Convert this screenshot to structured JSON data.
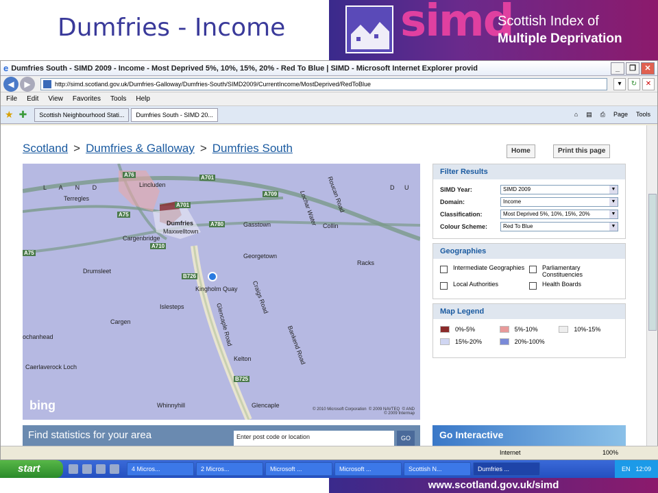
{
  "slide": {
    "title": "Dumfries - Income"
  },
  "banner": {
    "brand": "simd",
    "line1": "Scottish Index of",
    "line2": "Multiple Deprivation"
  },
  "browser": {
    "title": "Dumfries South - SIMD 2009 - Income - Most Deprived 5%, 10%, 15%, 20% - Red To Blue | SIMD - Microsoft Internet Explorer provid",
    "url": "http://simd.scotland.gov.uk/Dumfries-Galloway/Dumfries-South/SIMD2009/CurrentIncome/MostDeprived/RedToBlue",
    "menu": [
      "File",
      "Edit",
      "View",
      "Favorites",
      "Tools",
      "Help"
    ],
    "tabs": [
      "Scottish Neighbourhood Stati...",
      "Dumfries South - SIMD 20..."
    ],
    "tools": [
      "Page",
      "Tools"
    ],
    "status": {
      "zone": "Internet",
      "zoom": "100%"
    }
  },
  "breadcrumb": [
    "Scotland",
    "Dumfries & Galloway",
    "Dumfries South"
  ],
  "buttons": {
    "home": "Home",
    "print": "Print this page"
  },
  "filter": {
    "header": "Filter Results",
    "rows": [
      {
        "label": "SIMD Year:",
        "value": "SIMD 2009"
      },
      {
        "label": "Domain:",
        "value": "Income"
      },
      {
        "label": "Classification:",
        "value": "Most Deprived 5%, 10%, 15%, 20%"
      },
      {
        "label": "Colour Scheme:",
        "value": "Red To Blue"
      }
    ]
  },
  "geographies": {
    "header": "Geographies",
    "items": [
      "Intermediate Geographies",
      "Parliamentary Constituencies",
      "Local Authorities",
      "Health Boards"
    ]
  },
  "legend": {
    "header": "Map Legend",
    "items": [
      {
        "label": "0%-5%",
        "color": "#8a2a2a"
      },
      {
        "label": "5%-10%",
        "color": "#e89a9a"
      },
      {
        "label": "10%-15%",
        "color": "#eeeeee"
      },
      {
        "label": "15%-20%",
        "color": "#d0d6f2"
      },
      {
        "label": "20%-100%",
        "color": "#7a8ad8"
      }
    ]
  },
  "map": {
    "places": [
      "Lincluden",
      "Terregles",
      "Dumfries",
      "Maxwelltown",
      "Gasstown",
      "Collin",
      "Cargenbridge",
      "Georgetown",
      "Racks",
      "Drumsleet",
      "Kingholm Quay",
      "Islesteps",
      "Cargen",
      "Kelton",
      "ochanhead",
      "Caerlaverock Loch",
      "Whinnyhill",
      "Glencaple",
      "L A N D",
      "D U"
    ],
    "roads": [
      "A76",
      "A701",
      "A709",
      "A701",
      "A75",
      "A780",
      "A710",
      "A75",
      "B726",
      "B725",
      "Lochar Water",
      "Roucan Road",
      "Craigs Road",
      "Glencaple Road",
      "Bankend Road"
    ],
    "brand": "bing",
    "copyright": "© 2010 Microsoft Corporation  © 2009 NAVTEQ  © AND\n© 2009 Intermap"
  },
  "find": {
    "title": "Find statistics for your area",
    "placeholder": "Enter post code or location",
    "go": "GO"
  },
  "go_interactive": "Go Interactive",
  "taskbar": {
    "start": "start",
    "items": [
      "4 Micros...",
      "2 Micros...",
      "Microsoft ...",
      "Microsoft ...",
      "Scottish N...",
      "Dumfries ..."
    ],
    "lang": "EN",
    "time": "12:09"
  },
  "footer": "www.scotland.gov.uk/simd"
}
